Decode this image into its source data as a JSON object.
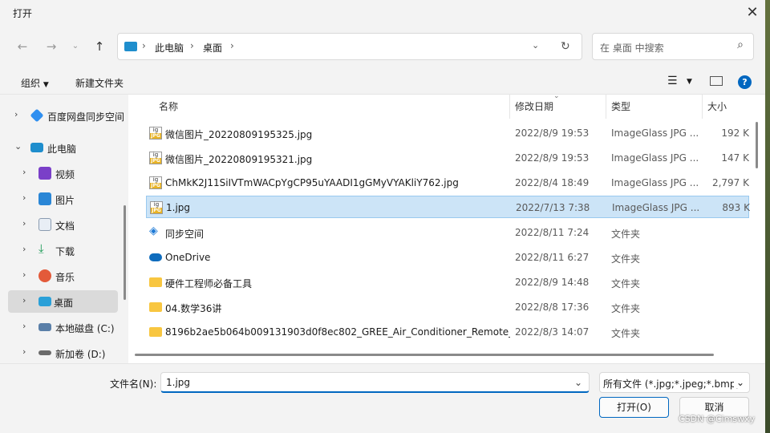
{
  "window": {
    "title": "打开"
  },
  "address": {
    "crumbs": [
      "此电脑",
      "桌面"
    ]
  },
  "search": {
    "placeholder": "在 桌面 中搜索"
  },
  "toolbar": {
    "organize": "组织",
    "new_folder": "新建文件夹",
    "help": "?"
  },
  "sidebar": {
    "items": [
      {
        "label": "百度网盘同步空间",
        "icon": "baidu-sync-icon"
      },
      {
        "label": "此电脑",
        "icon": "computer-icon"
      },
      {
        "label": "视频",
        "icon": "video-icon"
      },
      {
        "label": "图片",
        "icon": "pictures-icon"
      },
      {
        "label": "文档",
        "icon": "documents-icon"
      },
      {
        "label": "下载",
        "icon": "download-icon"
      },
      {
        "label": "音乐",
        "icon": "music-icon"
      },
      {
        "label": "桌面",
        "icon": "desktop-icon",
        "selected": true
      },
      {
        "label": "本地磁盘 (C:)",
        "icon": "drive-c-icon"
      },
      {
        "label": "新加卷 (D:)",
        "icon": "drive-d-icon"
      }
    ]
  },
  "columns": {
    "name": "名称",
    "date": "修改日期",
    "type": "类型",
    "size": "大小"
  },
  "files": [
    {
      "name": "微信图片_20220809195325.jpg",
      "date": "2022/8/9 19:53",
      "type": "ImageGlass JPG ...",
      "size": "192 K",
      "icon": "jpg-icon"
    },
    {
      "name": "微信图片_20220809195321.jpg",
      "date": "2022/8/9 19:53",
      "type": "ImageGlass JPG ...",
      "size": "147 K",
      "icon": "jpg-icon"
    },
    {
      "name": "ChMkK2J11SiIVTmWACpYgCP95uYAADI1gGMyVYAKliY762.jpg",
      "date": "2022/8/4 18:49",
      "type": "ImageGlass JPG ...",
      "size": "2,797 K",
      "icon": "jpg-icon"
    },
    {
      "name": "1.jpg",
      "date": "2022/7/13 7:38",
      "type": "ImageGlass JPG ...",
      "size": "893 K",
      "icon": "jpg-icon",
      "selected": true
    },
    {
      "name": "同步空间",
      "date": "2022/8/11 7:24",
      "type": "文件夹",
      "size": "",
      "icon": "sync-space-icon"
    },
    {
      "name": "OneDrive",
      "date": "2022/8/11 6:27",
      "type": "文件夹",
      "size": "",
      "icon": "onedrive-icon"
    },
    {
      "name": "硬件工程师必备工具",
      "date": "2022/8/9 14:48",
      "type": "文件夹",
      "size": "",
      "icon": "folder-icon"
    },
    {
      "name": "04.数学36讲",
      "date": "2022/8/8 17:36",
      "type": "文件夹",
      "size": "",
      "icon": "folder-icon"
    },
    {
      "name": "8196b2ae5b064b009131903d0f8ec802_GREE_Air_Conditioner_Remote_...",
      "date": "2022/8/3 14:07",
      "type": "文件夹",
      "size": "",
      "icon": "folder-icon"
    }
  ],
  "footer": {
    "filename_label": "文件名(N):",
    "filename_value": "1.jpg",
    "filetype_value": "所有文件 (*.jpg;*.jpeg;*.bmp;*",
    "open_label": "打开(O)",
    "cancel_label": "取消"
  },
  "watermark": "CSDN @Cimswxy",
  "colors": {
    "accent": "#0067c0",
    "selection": "#cce4f7",
    "folder": "#f8c640"
  }
}
